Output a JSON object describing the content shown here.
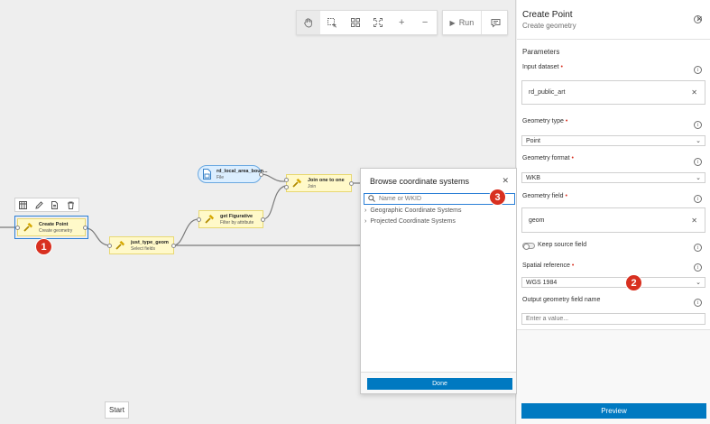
{
  "toolbar": {
    "tools": [
      "pan-tool",
      "select-tool",
      "layout-tool",
      "fit-tool",
      "zoom-in",
      "zoom-out"
    ],
    "zoom_in": "+",
    "zoom_out": "−",
    "run_label": "Run"
  },
  "nodes": {
    "create_point": {
      "title": "Create Point",
      "subtitle": "Create geometry"
    },
    "just_type_geom": {
      "title": "just_type_geom",
      "subtitle": "Select fields"
    },
    "get_figurative": {
      "title": "get Figurative",
      "subtitle": "Filter by attribute"
    },
    "rd_local_area": {
      "title": "rd_local_area_boun...",
      "subtitle": "File"
    },
    "join_one_to_one": {
      "title": "Join one to one",
      "subtitle": "Join"
    }
  },
  "badges": {
    "one": "1",
    "two": "2",
    "three": "3"
  },
  "start_label": "Start",
  "browse": {
    "title": "Browse coordinate systems",
    "search_placeholder": "Name or WKID",
    "tree": [
      "Geographic Coordinate Systems",
      "Projected Coordinate Systems"
    ],
    "done_label": "Done"
  },
  "panel": {
    "title": "Create Point",
    "subtitle": "Create geometry",
    "section": "Parameters",
    "input_dataset": {
      "label": "Input dataset",
      "value": "rd_public_art"
    },
    "geometry_type": {
      "label": "Geometry type",
      "value": "Point"
    },
    "geometry_format": {
      "label": "Geometry format",
      "value": "WKB"
    },
    "geometry_field": {
      "label": "Geometry field",
      "value": "geom"
    },
    "keep_source": {
      "label": "Keep source field"
    },
    "spatial_reference": {
      "label": "Spatial reference",
      "value": "WGS 1984"
    },
    "output_field": {
      "label": "Output geometry field name",
      "placeholder": "Enter a value..."
    },
    "preview_label": "Preview"
  },
  "colors": {
    "accent": "#0079c1",
    "badge": "#d83020",
    "node_fill": "#fff9c9",
    "file_fill": "#dbeeff"
  }
}
